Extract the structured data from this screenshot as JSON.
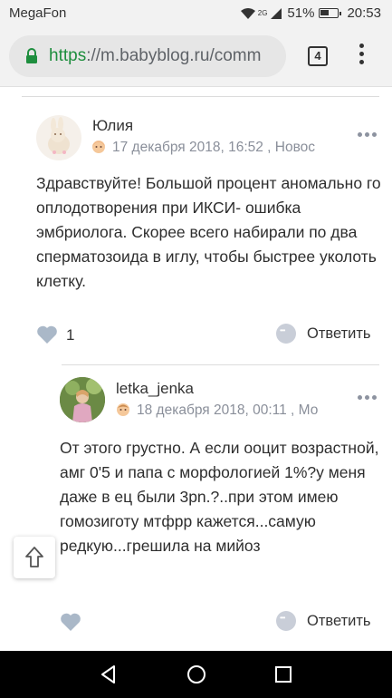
{
  "status_bar": {
    "carrier": "MegaFon",
    "network": "2G",
    "battery": "51%",
    "time": "20:53"
  },
  "browser": {
    "url_scheme": "https",
    "url_rest": "://m.babyblog.ru/comm",
    "tab_count": "4"
  },
  "comments": [
    {
      "author": "Юлия",
      "meta": "17 декабря 2018, 16:52 , Новос",
      "text": "Здравствуйте! Большой процент аномально го оплодотворения при ИКСИ- ошибка эмбриолога. Скорее всего набирали по два сперматозоида в иглу, чтобы быстрее уколоть клетку.",
      "likes": "1",
      "reply_label": "Ответить"
    },
    {
      "author": "letka_jenka",
      "meta": "18 декабря 2018, 00:11 , Мо",
      "text": "От этого грустно. А если ооцит возрастной, амг 0'5 и папа с морфологией 1%?у меня даже в ец были 3pn.?..при этом имею гомозиготу мтфрр кажется...самую редкую...грешила на мийоз",
      "reply_label": "Ответить"
    }
  ],
  "colors": {
    "heart": "#aab8c8",
    "meta_text": "#8a8f9a",
    "url_green": "#1e8e3e"
  }
}
